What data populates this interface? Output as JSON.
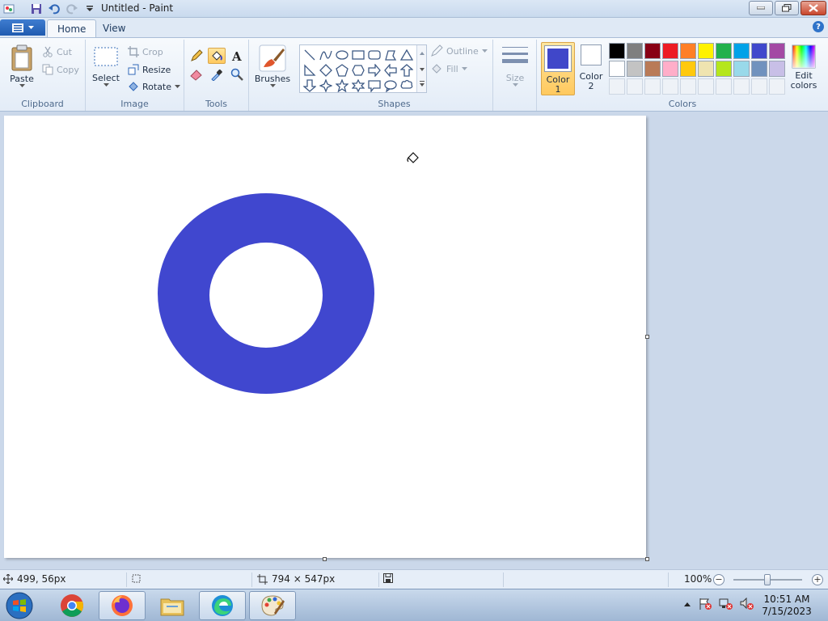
{
  "window": {
    "title": "Untitled - Paint"
  },
  "tabs": [
    {
      "label": "Home",
      "active": true
    },
    {
      "label": "View",
      "active": false
    }
  ],
  "ribbon": {
    "clipboard": {
      "label": "Clipboard",
      "paste": "Paste",
      "cut": "Cut",
      "copy": "Copy"
    },
    "image": {
      "label": "Image",
      "select": "Select",
      "crop": "Crop",
      "resize": "Resize",
      "rotate": "Rotate"
    },
    "tools": {
      "label": "Tools"
    },
    "brushes": {
      "label": "Brushes"
    },
    "shapes": {
      "label": "Shapes",
      "outline": "Outline",
      "fill": "Fill"
    },
    "size": {
      "label": "Size"
    },
    "colors": {
      "label": "Colors",
      "color1_line1": "Color",
      "color1_line2": "1",
      "color2_line1": "Color",
      "color2_line2": "2",
      "edit_line1": "Edit",
      "edit_line2": "colors",
      "color1_value": "#4047c9",
      "color2_value": "#ffffff",
      "palette_row1": [
        "#000000",
        "#7f7f7f",
        "#880015",
        "#ed1c24",
        "#ff7f27",
        "#fff200",
        "#22b14c",
        "#00a2e8",
        "#3f48cc",
        "#a349a4"
      ],
      "palette_row2": [
        "#ffffff",
        "#c3c3c3",
        "#b97a57",
        "#ffaec9",
        "#ffc90e",
        "#efe4b0",
        "#b5e61d",
        "#99d9ea",
        "#7092be",
        "#c8bfe7"
      ]
    }
  },
  "canvas": {
    "background": "#ffffff",
    "ring_color": "#4047cf"
  },
  "status": {
    "cursor_pos": "499, 56px",
    "canvas_size": "794 × 547px",
    "zoom": "100%"
  },
  "taskbar": {
    "time": "10:51 AM",
    "date": "7/15/2023"
  }
}
